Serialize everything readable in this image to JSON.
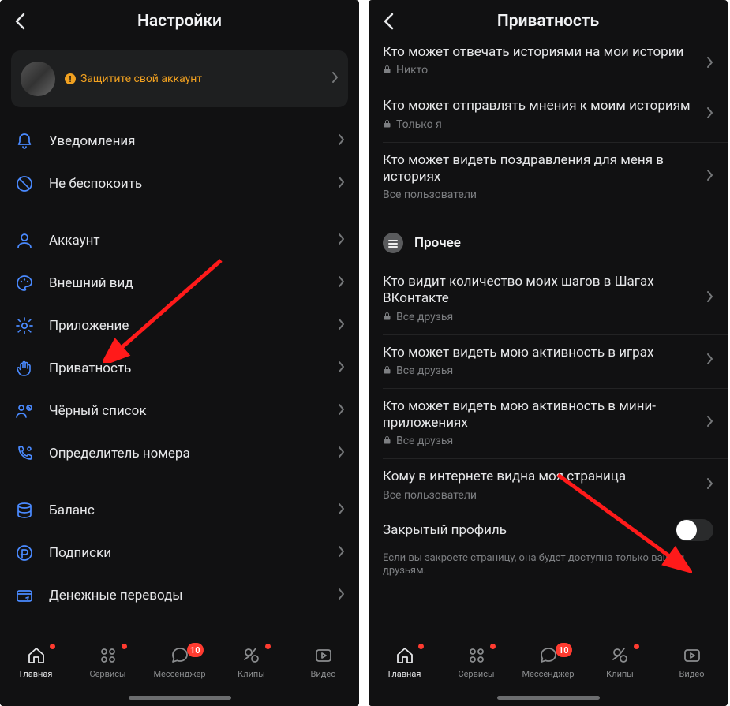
{
  "left": {
    "title": "Настройки",
    "protect": "Защитите свой аккаунт",
    "group1": [
      {
        "icon": "bell",
        "label": "Уведомления"
      },
      {
        "icon": "dnd",
        "label": "Не беспокоить"
      }
    ],
    "group2": [
      {
        "icon": "account",
        "label": "Аккаунт"
      },
      {
        "icon": "palette",
        "label": "Внешний вид"
      },
      {
        "icon": "gear",
        "label": "Приложение"
      },
      {
        "icon": "hand",
        "label": "Приватность"
      },
      {
        "icon": "blacklist",
        "label": "Чёрный список"
      },
      {
        "icon": "callerid",
        "label": "Определитель номера"
      }
    ],
    "group3": [
      {
        "icon": "balance",
        "label": "Баланс"
      },
      {
        "icon": "subs",
        "label": "Подписки"
      },
      {
        "icon": "transfer",
        "label": "Денежные переводы"
      }
    ]
  },
  "right": {
    "title": "Приватность",
    "rows1": [
      {
        "title": "Кто может отвечать историями на мои истории",
        "sub": "Никто",
        "locked": true
      },
      {
        "title": "Кто может отправлять мнения к моим историям",
        "sub": "Только я",
        "locked": true
      },
      {
        "title": "Кто может видеть поздравления для меня в историях",
        "sub": "Все пользователи",
        "locked": false
      }
    ],
    "section": "Прочее",
    "rows2": [
      {
        "title": "Кто видит количество моих шагов в Шагах ВКонтакте",
        "sub": "Все друзья",
        "locked": true
      },
      {
        "title": "Кто может видеть мою активность в играх",
        "sub": "Все друзья",
        "locked": true
      },
      {
        "title": "Кто может видеть мою активность в мини-приложениях",
        "sub": "Все друзья",
        "locked": true
      },
      {
        "title": "Кому в интернете видна моя страница",
        "sub": "Все пользователи",
        "locked": false
      }
    ],
    "toggle": {
      "title": "Закрытый профиль"
    },
    "hint": "Если вы закроете страницу, она будет доступна только вашим друзьям."
  },
  "tabs": [
    {
      "label": "Главная",
      "icon": "home",
      "active": true,
      "dot": true
    },
    {
      "label": "Сервисы",
      "icon": "services",
      "dot": true
    },
    {
      "label": "Мессенджер",
      "icon": "chat",
      "badge": "10"
    },
    {
      "label": "Клипы",
      "icon": "clips",
      "dot": true
    },
    {
      "label": "Видео",
      "icon": "video"
    }
  ]
}
